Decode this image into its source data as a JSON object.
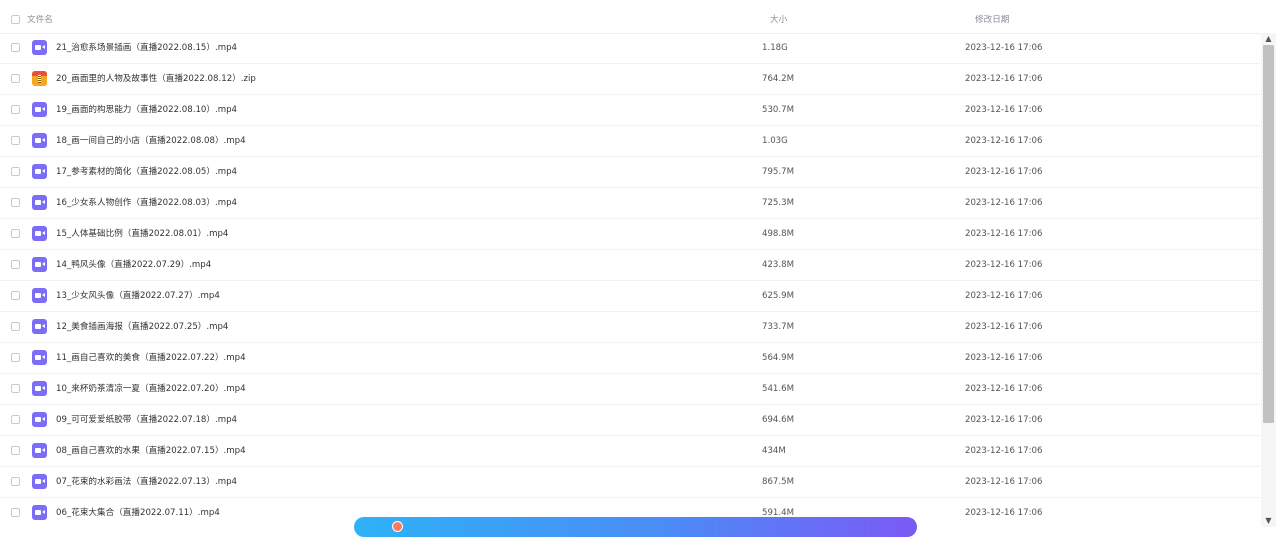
{
  "header": {
    "name_label": "文件名",
    "size_label": "大小",
    "date_label": "修改日期"
  },
  "files": [
    {
      "name": "21_治愈系场景插画（直播2022.08.15）.mp4",
      "size": "1.18G",
      "date": "2023-12-16 17:06",
      "type": "video"
    },
    {
      "name": "20_画面里的人物及故事性（直播2022.08.12）.zip",
      "size": "764.2M",
      "date": "2023-12-16 17:06",
      "type": "archive"
    },
    {
      "name": "19_画面的构思能力（直播2022.08.10）.mp4",
      "size": "530.7M",
      "date": "2023-12-16 17:06",
      "type": "video"
    },
    {
      "name": "18_画一间自己的小店（直播2022.08.08）.mp4",
      "size": "1.03G",
      "date": "2023-12-16 17:06",
      "type": "video"
    },
    {
      "name": "17_参考素材的简化（直播2022.08.05）.mp4",
      "size": "795.7M",
      "date": "2023-12-16 17:06",
      "type": "video"
    },
    {
      "name": "16_少女系人物创作（直播2022.08.03）.mp4",
      "size": "725.3M",
      "date": "2023-12-16 17:06",
      "type": "video"
    },
    {
      "name": "15_人体基础比例（直播2022.08.01）.mp4",
      "size": "498.8M",
      "date": "2023-12-16 17:06",
      "type": "video"
    },
    {
      "name": "14_鸭风头像（直播2022.07.29）.mp4",
      "size": "423.8M",
      "date": "2023-12-16 17:06",
      "type": "video"
    },
    {
      "name": "13_少女风头像（直播2022.07.27）.mp4",
      "size": "625.9M",
      "date": "2023-12-16 17:06",
      "type": "video"
    },
    {
      "name": "12_美食插画海报（直播2022.07.25）.mp4",
      "size": "733.7M",
      "date": "2023-12-16 17:06",
      "type": "video"
    },
    {
      "name": "11_画自己喜欢的美食（直播2022.07.22）.mp4",
      "size": "564.9M",
      "date": "2023-12-16 17:06",
      "type": "video"
    },
    {
      "name": "10_来杯奶茶清凉一夏（直播2022.07.20）.mp4",
      "size": "541.6M",
      "date": "2023-12-16 17:06",
      "type": "video"
    },
    {
      "name": "09_可可爱爱纸胶带（直播2022.07.18）.mp4",
      "size": "694.6M",
      "date": "2023-12-16 17:06",
      "type": "video"
    },
    {
      "name": "08_画自己喜欢的水果（直播2022.07.15）.mp4",
      "size": "434M",
      "date": "2023-12-16 17:06",
      "type": "video"
    },
    {
      "name": "07_花束的水彩画法（直播2022.07.13）.mp4",
      "size": "867.5M",
      "date": "2023-12-16 17:06",
      "type": "video"
    },
    {
      "name": "06_花束大集合（直播2022.07.11）.mp4",
      "size": "591.4M",
      "date": "2023-12-16 17:06",
      "type": "video"
    }
  ],
  "icons": {
    "video": "video-file-icon",
    "archive": "zip-archive-icon",
    "scroll_up": "chevron-up-icon",
    "scroll_down": "chevron-down-icon"
  },
  "colors": {
    "video_icon": "#7b6df7",
    "promo_gradient_start": "#2eb2f7",
    "promo_gradient_end": "#7b5af5"
  }
}
